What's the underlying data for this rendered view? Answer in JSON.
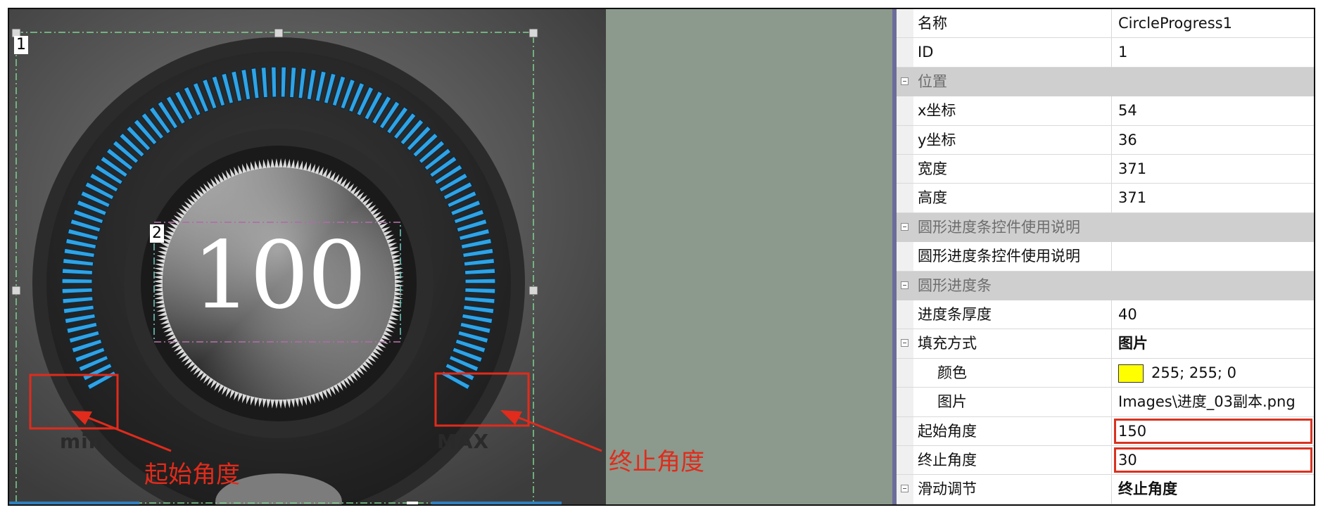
{
  "canvas": {
    "control_labels": [
      "1",
      "2"
    ],
    "value": "100",
    "scale": {
      "min": "min",
      "max": "MAX"
    },
    "annotations": {
      "start": "起始角度",
      "end": "终止角度"
    },
    "progress": {
      "start_angle_deg": 150,
      "end_angle_deg": 30,
      "fill_fraction": 1.0
    },
    "colors": {
      "bar": "#2fa3e6",
      "annotation": "#e12b1c",
      "side_panel": "#8b9a8c"
    }
  },
  "properties": {
    "rows": [
      {
        "id": "name",
        "type": "prop",
        "key": "名称",
        "value": "CircleProgress1"
      },
      {
        "id": "id",
        "type": "prop",
        "key": "ID",
        "value": "1"
      },
      {
        "id": "pos",
        "type": "category",
        "key": "位置"
      },
      {
        "id": "x",
        "type": "prop",
        "key": "x坐标",
        "value": "54"
      },
      {
        "id": "y",
        "type": "prop",
        "key": "y坐标",
        "value": "36"
      },
      {
        "id": "w",
        "type": "prop",
        "key": "宽度",
        "value": "371"
      },
      {
        "id": "h",
        "type": "prop",
        "key": "高度",
        "value": "371"
      },
      {
        "id": "desc-cat",
        "type": "category",
        "key": "圆形进度条控件使用说明"
      },
      {
        "id": "desc",
        "type": "prop",
        "key": "圆形进度条控件使用说明",
        "value": ""
      },
      {
        "id": "circ",
        "type": "category",
        "key": "圆形进度条"
      },
      {
        "id": "thick",
        "type": "prop",
        "key": "进度条厚度",
        "value": "40"
      },
      {
        "id": "fill",
        "type": "prop",
        "key": "填充方式",
        "value": "图片",
        "toggle": true,
        "bold": true
      },
      {
        "id": "color",
        "type": "prop",
        "key": "颜色",
        "value": "255; 255; 0",
        "indent": true,
        "swatch": "#ffff00"
      },
      {
        "id": "img",
        "type": "prop",
        "key": "图片",
        "value": "Images\\进度_03副本.png",
        "indent": true
      },
      {
        "id": "start",
        "type": "prop",
        "key": "起始角度",
        "value": "150",
        "highlight": true
      },
      {
        "id": "end",
        "type": "prop",
        "key": "终止角度",
        "value": "30",
        "highlight": true
      },
      {
        "id": "slide",
        "type": "prop",
        "key": "滑动调节",
        "value": "终止角度",
        "toggle": true,
        "bold": true
      }
    ]
  }
}
